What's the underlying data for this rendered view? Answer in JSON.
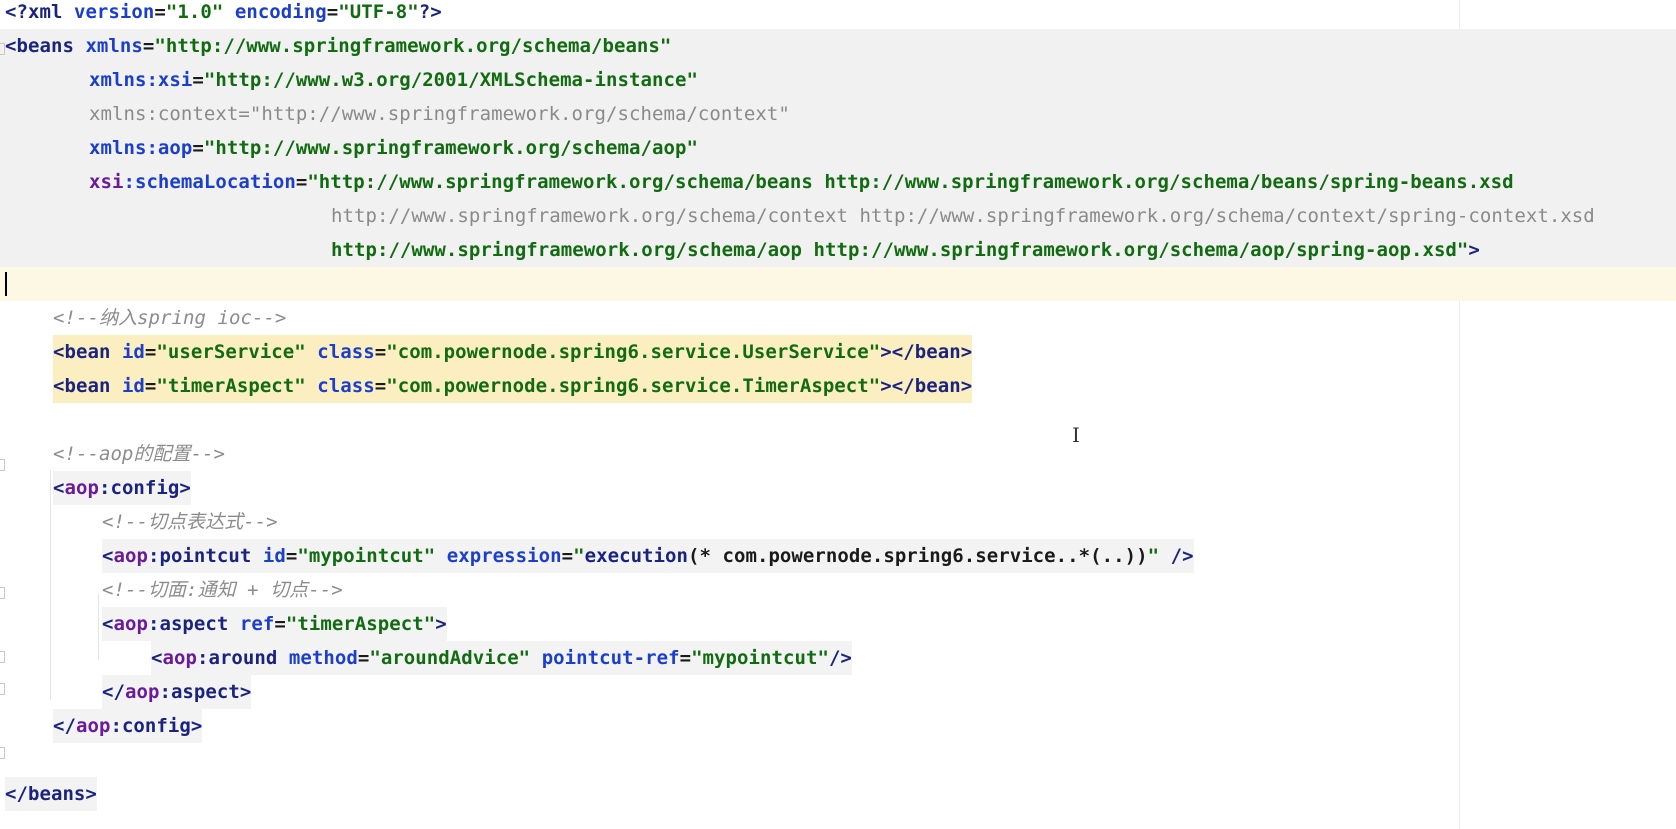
{
  "editor": {
    "lines": [
      {
        "id": "l1",
        "tokens": [
          [
            "pi",
            "<?"
          ],
          [
            "tag",
            "xml "
          ],
          [
            "attr",
            "version"
          ],
          [
            "plain",
            "="
          ],
          [
            "val",
            "\"1.0\""
          ],
          [
            "plain",
            " "
          ],
          [
            "attr",
            "encoding"
          ],
          [
            "plain",
            "="
          ],
          [
            "val",
            "\"UTF-8\""
          ],
          [
            "pi",
            "?>"
          ]
        ]
      },
      {
        "id": "l2",
        "tokens": [
          [
            "tag",
            "<beans "
          ],
          [
            "attr",
            "xmlns"
          ],
          [
            "plain",
            "="
          ],
          [
            "val",
            "\"http://www.springframework.org/schema/beans\""
          ]
        ]
      },
      {
        "id": "l3",
        "tokens": [
          [
            "attr",
            "xmlns:xsi"
          ],
          [
            "plain",
            "="
          ],
          [
            "val",
            "\"http://www.w3.org/2001/XMLSchema-instance\""
          ]
        ]
      },
      {
        "id": "l4",
        "tokens": [
          [
            "dim",
            "xmlns:context"
          ],
          [
            "dim",
            "="
          ],
          [
            "dimval",
            "\"http://www.springframework.org/schema/context\""
          ]
        ]
      },
      {
        "id": "l5",
        "tokens": [
          [
            "attr",
            "xmlns:aop"
          ],
          [
            "plain",
            "="
          ],
          [
            "val",
            "\"http://www.springframework.org/schema/aop\""
          ]
        ]
      },
      {
        "id": "l6",
        "tokens": [
          [
            "aopns",
            "xsi"
          ],
          [
            "attr",
            ":schemaLocation"
          ],
          [
            "plain",
            "="
          ],
          [
            "val",
            "\"http://www.springframework.org/schema/beans http://www.springframework.org/schema/beans/spring-beans.xsd"
          ]
        ]
      },
      {
        "id": "l7",
        "tokens": [
          [
            "dimval",
            "http://www.springframework.org/schema/context http://www.springframework.org/schema/context/spring-context.xsd"
          ]
        ]
      },
      {
        "id": "l8",
        "tokens": [
          [
            "val",
            "http://www.springframework.org/schema/aop http://www.springframework.org/schema/aop/spring-aop.xsd\""
          ],
          [
            "tag",
            ">"
          ]
        ]
      },
      {
        "id": "l9",
        "tokens": []
      },
      {
        "id": "l10",
        "tokens": [
          [
            "comment",
            "<!--纳入spring ioc-->"
          ]
        ]
      },
      {
        "id": "l11",
        "tokens": [
          [
            "tag",
            "<bean "
          ],
          [
            "attr",
            "id"
          ],
          [
            "plain",
            "="
          ],
          [
            "val",
            "\"userService\""
          ],
          [
            "plain",
            " "
          ],
          [
            "attr",
            "class"
          ],
          [
            "plain",
            "="
          ],
          [
            "val",
            "\"com.powernode.spring6.service.UserService\""
          ],
          [
            "tag",
            "></bean>"
          ]
        ]
      },
      {
        "id": "l12",
        "tokens": [
          [
            "tag",
            "<bean "
          ],
          [
            "attr",
            "id"
          ],
          [
            "plain",
            "="
          ],
          [
            "val",
            "\"timerAspect\""
          ],
          [
            "plain",
            " "
          ],
          [
            "attr",
            "class"
          ],
          [
            "plain",
            "="
          ],
          [
            "val",
            "\"com.powernode.spring6.service.TimerAspect\""
          ],
          [
            "tag",
            "></bean>"
          ]
        ]
      },
      {
        "id": "l13",
        "tokens": []
      },
      {
        "id": "l14",
        "tokens": [
          [
            "comment",
            "<!--aop的配置-->"
          ]
        ]
      },
      {
        "id": "l15",
        "tokens": [
          [
            "tag",
            "<"
          ],
          [
            "aopns",
            "aop"
          ],
          [
            "tag",
            ":config>"
          ]
        ]
      },
      {
        "id": "l16",
        "tokens": [
          [
            "comment",
            "<!--切点表达式-->"
          ]
        ]
      },
      {
        "id": "l17",
        "tokens": [
          [
            "tag",
            "<"
          ],
          [
            "aopns",
            "aop"
          ],
          [
            "tag",
            ":pointcut "
          ],
          [
            "attr",
            "id"
          ],
          [
            "plain",
            "="
          ],
          [
            "val",
            "\"mypointcut\""
          ],
          [
            "plain",
            " "
          ],
          [
            "attr",
            "expression"
          ],
          [
            "plain",
            "="
          ],
          [
            "val",
            "\""
          ],
          [
            "tag",
            "execution"
          ],
          [
            "plain",
            "(* com.powernode.spring6.service..*(..))"
          ],
          [
            "val",
            "\""
          ],
          [
            "plain",
            " "
          ],
          [
            "tag",
            "/>"
          ]
        ]
      },
      {
        "id": "l18",
        "tokens": [
          [
            "comment",
            "<!--切面:通知 + 切点-->"
          ]
        ]
      },
      {
        "id": "l19",
        "tokens": [
          [
            "tag",
            "<"
          ],
          [
            "aopns",
            "aop"
          ],
          [
            "tag",
            ":aspect "
          ],
          [
            "attr",
            "ref"
          ],
          [
            "plain",
            "="
          ],
          [
            "val",
            "\"timerAspect\""
          ],
          [
            "tag",
            ">"
          ]
        ]
      },
      {
        "id": "l20",
        "tokens": [
          [
            "tag",
            "<"
          ],
          [
            "aopns",
            "aop"
          ],
          [
            "tag",
            ":around "
          ],
          [
            "attr",
            "method"
          ],
          [
            "plain",
            "="
          ],
          [
            "val",
            "\"aroundAdvice\""
          ],
          [
            "plain",
            " "
          ],
          [
            "attr",
            "pointcut-ref"
          ],
          [
            "plain",
            "="
          ],
          [
            "val",
            "\"mypointcut\""
          ],
          [
            "tag",
            "/>"
          ]
        ]
      },
      {
        "id": "l21",
        "tokens": [
          [
            "tag",
            "</"
          ],
          [
            "aopns",
            "aop"
          ],
          [
            "tag",
            ":aspect>"
          ]
        ]
      },
      {
        "id": "l22",
        "tokens": [
          [
            "tag",
            "</"
          ],
          [
            "aopns",
            "aop"
          ],
          [
            "tag",
            ":config>"
          ]
        ]
      },
      {
        "id": "l23",
        "tokens": []
      },
      {
        "id": "l24",
        "tokens": [
          [
            "tag",
            "</beans>"
          ]
        ]
      }
    ]
  }
}
